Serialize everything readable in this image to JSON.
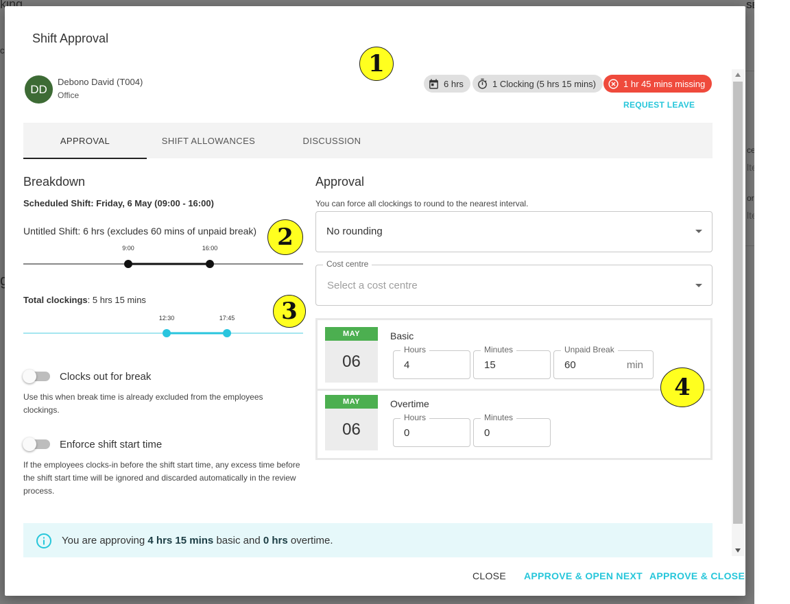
{
  "background": {
    "title_fragment": "king",
    "search_fragment": "SE",
    "left_fragment_1": "cl",
    "left_fragment_2": "g",
    "right_fragment_1": "ce",
    "right_fragment_2": "lte",
    "right_fragment_3": "orl",
    "right_fragment_4": "lte"
  },
  "modal": {
    "title": "Shift Approval"
  },
  "employee": {
    "initials": "DD",
    "name": "Debono David (T004)",
    "department": "Office"
  },
  "chips": {
    "scheduled_hours": "6 hrs",
    "clockings": "1 Clocking (5 hrs 15 mins)",
    "missing": "1 hr 45 mins missing"
  },
  "request_leave_label": "REQUEST LEAVE",
  "tabs": [
    {
      "label": "APPROVAL",
      "active": true
    },
    {
      "label": "SHIFT ALLOWANCES",
      "active": false
    },
    {
      "label": "DISCUSSION",
      "active": false
    }
  ],
  "breakdown": {
    "title": "Breakdown",
    "scheduled_shift": "Scheduled Shift: Friday, 6 May (09:00 - 16:00)",
    "shift_desc": "Untitled Shift: 6 hrs (excludes 60 mins of unpaid break)",
    "shift_start": "9:00",
    "shift_end": "16:00",
    "total_clockings_label": "Total clockings",
    "total_clockings_value": ": 5 hrs 15 mins",
    "clock_in": "12:30",
    "clock_out": "17:45",
    "clocks_out_label": "Clocks out for break",
    "clocks_out_help": "Use this when break time is already excluded from the employees clockings.",
    "enforce_label": "Enforce shift start time",
    "enforce_help": "If the employees clocks-in before the shift start time, any excess time before the shift start time will be ignored and discarded automatically in the review process."
  },
  "approval": {
    "title": "Approval",
    "description": "You can force all clockings to round to the nearest interval.",
    "rounding_value": "No rounding",
    "cost_centre_label": "Cost centre",
    "cost_centre_placeholder": "Select a cost centre",
    "basic": {
      "month": "MAY",
      "day": "06",
      "title": "Basic",
      "hours_label": "Hours",
      "hours_value": "4",
      "minutes_label": "Minutes",
      "minutes_value": "15",
      "break_label": "Unpaid Break",
      "break_value": "60",
      "break_unit": "min"
    },
    "overtime": {
      "month": "MAY",
      "day": "06",
      "title": "Overtime",
      "hours_label": "Hours",
      "hours_value": "0",
      "minutes_label": "Minutes",
      "minutes_value": "0"
    }
  },
  "info": {
    "prefix": "You are approving ",
    "basic_amount": "4 hrs 15 mins",
    "middle": " basic and ",
    "overtime_amount": "0 hrs",
    "suffix": " overtime."
  },
  "footer": {
    "close": "CLOSE",
    "approve_next": "APPROVE & OPEN NEXT",
    "approve_close": "APPROVE & CLOSE"
  },
  "markers": [
    "1",
    "2",
    "3",
    "4"
  ],
  "colors": {
    "accent": "#26c6da",
    "missing_red": "#ef4a3c",
    "avatar_green": "#3d6b35",
    "date_green": "#4caf50",
    "clocking_line": "#29c5de",
    "marker_yellow": "#ffff1f"
  },
  "icons": {
    "calendar": "calendar-icon",
    "stopwatch": "stopwatch-icon",
    "missing": "cancel-circle-icon",
    "info": "info-icon",
    "dropdown": "caret-down-icon"
  }
}
